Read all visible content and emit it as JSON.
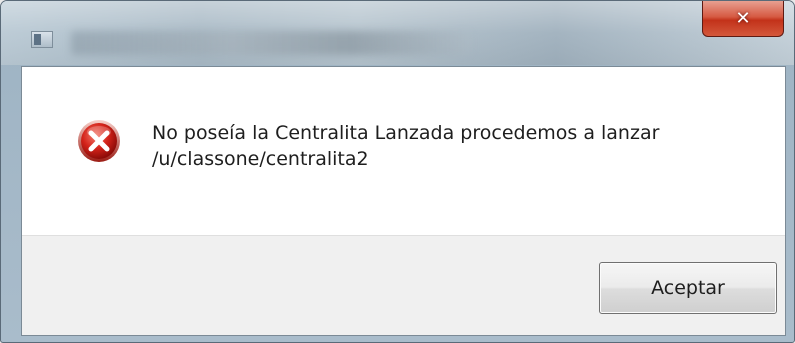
{
  "window": {
    "close_glyph": "✕",
    "app_icon": "window-app-icon",
    "accent_close": "#c3321a"
  },
  "message": {
    "icon": "error-icon",
    "lines": [
      "No poseía la Centralita Lanzada procedemos a lanzar",
      "/u/classone/centralita2"
    ]
  },
  "buttons": {
    "accept_label": "Aceptar"
  }
}
